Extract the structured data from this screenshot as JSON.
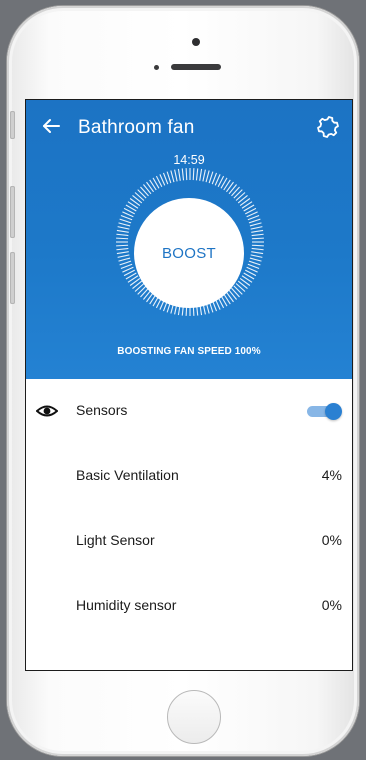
{
  "header": {
    "title": "Bathroom fan",
    "timer": "14:59",
    "boost_label": "BOOST",
    "status": "BOOSTING FAN SPEED 100%"
  },
  "sensors": {
    "label": "Sensors",
    "toggle_on": true,
    "items": [
      {
        "label": "Basic Ventilation",
        "value": "4%"
      },
      {
        "label": "Light Sensor",
        "value": "0%"
      },
      {
        "label": "Humidity sensor",
        "value": "0%"
      }
    ]
  },
  "icons": {
    "back": "arrow-left",
    "settings": "gear",
    "sensors": "eye"
  },
  "colors": {
    "header_blue": "#1e76c8",
    "toggle_blue": "#2a80d2",
    "background": "#ffffff"
  }
}
